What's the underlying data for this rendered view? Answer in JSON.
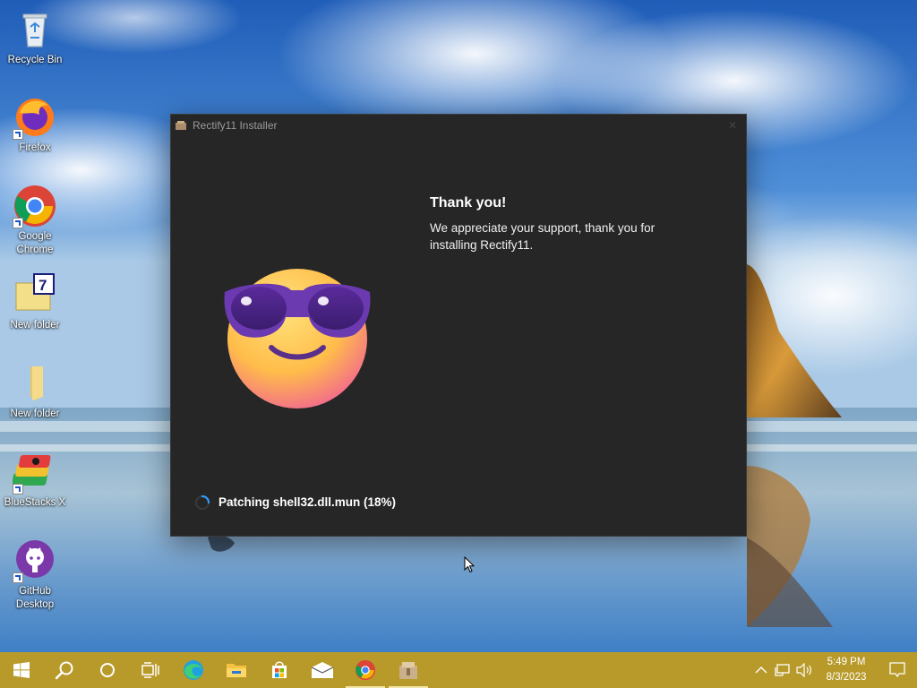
{
  "desktop": {
    "icons": [
      {
        "label": "Recycle Bin",
        "icon": "recycle-bin-icon"
      },
      {
        "label": "Firefox",
        "icon": "firefox-icon"
      },
      {
        "label": "Google Chrome",
        "icon": "chrome-icon"
      },
      {
        "label": "New folder",
        "icon": "folder-7zip-icon"
      },
      {
        "label": "New folder",
        "icon": "folder-icon"
      },
      {
        "label": "BlueStacks X",
        "icon": "bluestacks-icon"
      },
      {
        "label": "GitHub Desktop",
        "icon": "github-desktop-icon"
      }
    ]
  },
  "installer": {
    "title": "Rectify11 Installer",
    "close_glyph": "✕",
    "heading": "Thank you!",
    "message": "We appreciate your support, thank you for installing Rectify11.",
    "status": "Patching shell32.dll.mun (18%)",
    "progress_percent": 18,
    "illustration": "smiling-face-with-sunglasses-emoji"
  },
  "taskbar": {
    "color": "#b89a2a",
    "buttons": [
      {
        "icon": "start-icon"
      },
      {
        "icon": "search-icon"
      },
      {
        "icon": "cortana-icon"
      },
      {
        "icon": "task-view-icon"
      },
      {
        "icon": "edge-icon"
      },
      {
        "icon": "file-explorer-icon"
      },
      {
        "icon": "store-icon"
      },
      {
        "icon": "mail-icon"
      },
      {
        "icon": "chrome-icon",
        "active": true
      },
      {
        "icon": "installer-icon"
      }
    ],
    "tray": {
      "icons": [
        "chevron-up-icon",
        "network-icon",
        "volume-icon"
      ],
      "time": "5:49 PM",
      "date": "8/3/2023",
      "notification_icon": "action-center-icon"
    }
  }
}
